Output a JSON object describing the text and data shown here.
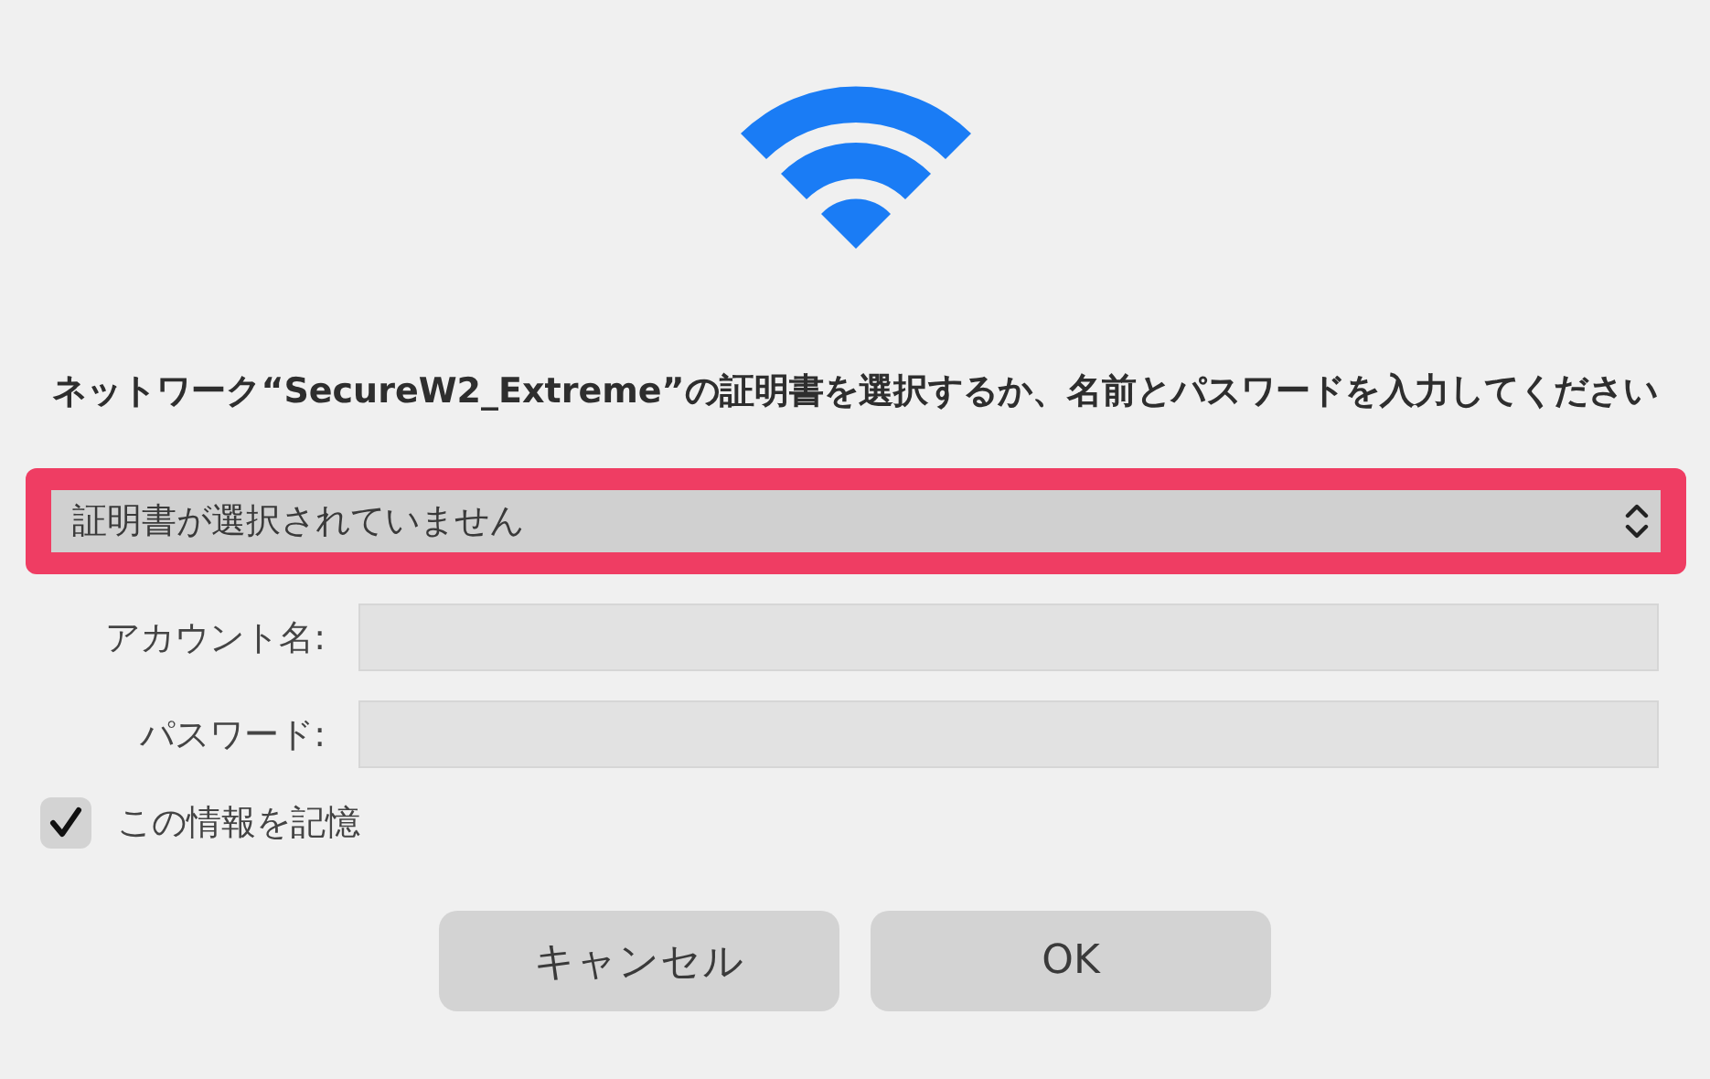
{
  "message": "ネットワーク“SecureW2_Extreme”の証明書を選択するか、名前とパスワードを入力してください",
  "certificate_select": {
    "value": "証明書が選択されていません",
    "highlighted": true
  },
  "fields": [
    {
      "label": "アカウント名:"
    },
    {
      "label": "パスワード:"
    }
  ],
  "remember": {
    "label": "この情報を記憶",
    "checked": true
  },
  "buttons": [
    {
      "label": "キャンセル"
    },
    {
      "label": "OK"
    }
  ]
}
